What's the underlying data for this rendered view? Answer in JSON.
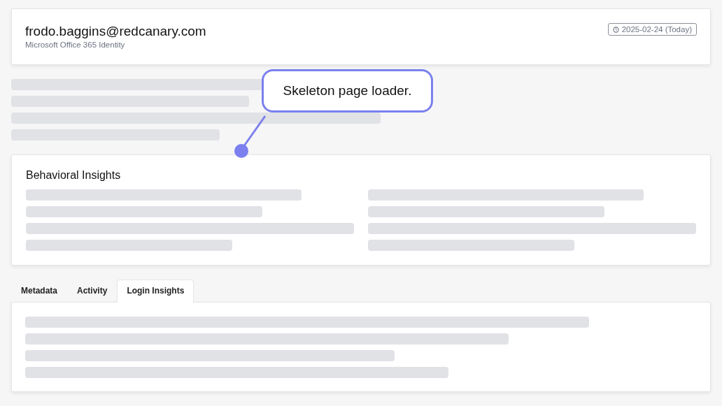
{
  "header": {
    "title": "frodo.baggins@redcanary.com",
    "subtitle": "Microsoft Office 365 Identity",
    "date_badge": "2025-02-24 (Today)"
  },
  "callout": {
    "text": "Skeleton page loader."
  },
  "insights": {
    "title": "Behavioral Insights"
  },
  "tabs": [
    {
      "label": "Metadata",
      "selected": false
    },
    {
      "label": "Activity",
      "selected": false
    },
    {
      "label": "Login Insights",
      "selected": true
    }
  ]
}
